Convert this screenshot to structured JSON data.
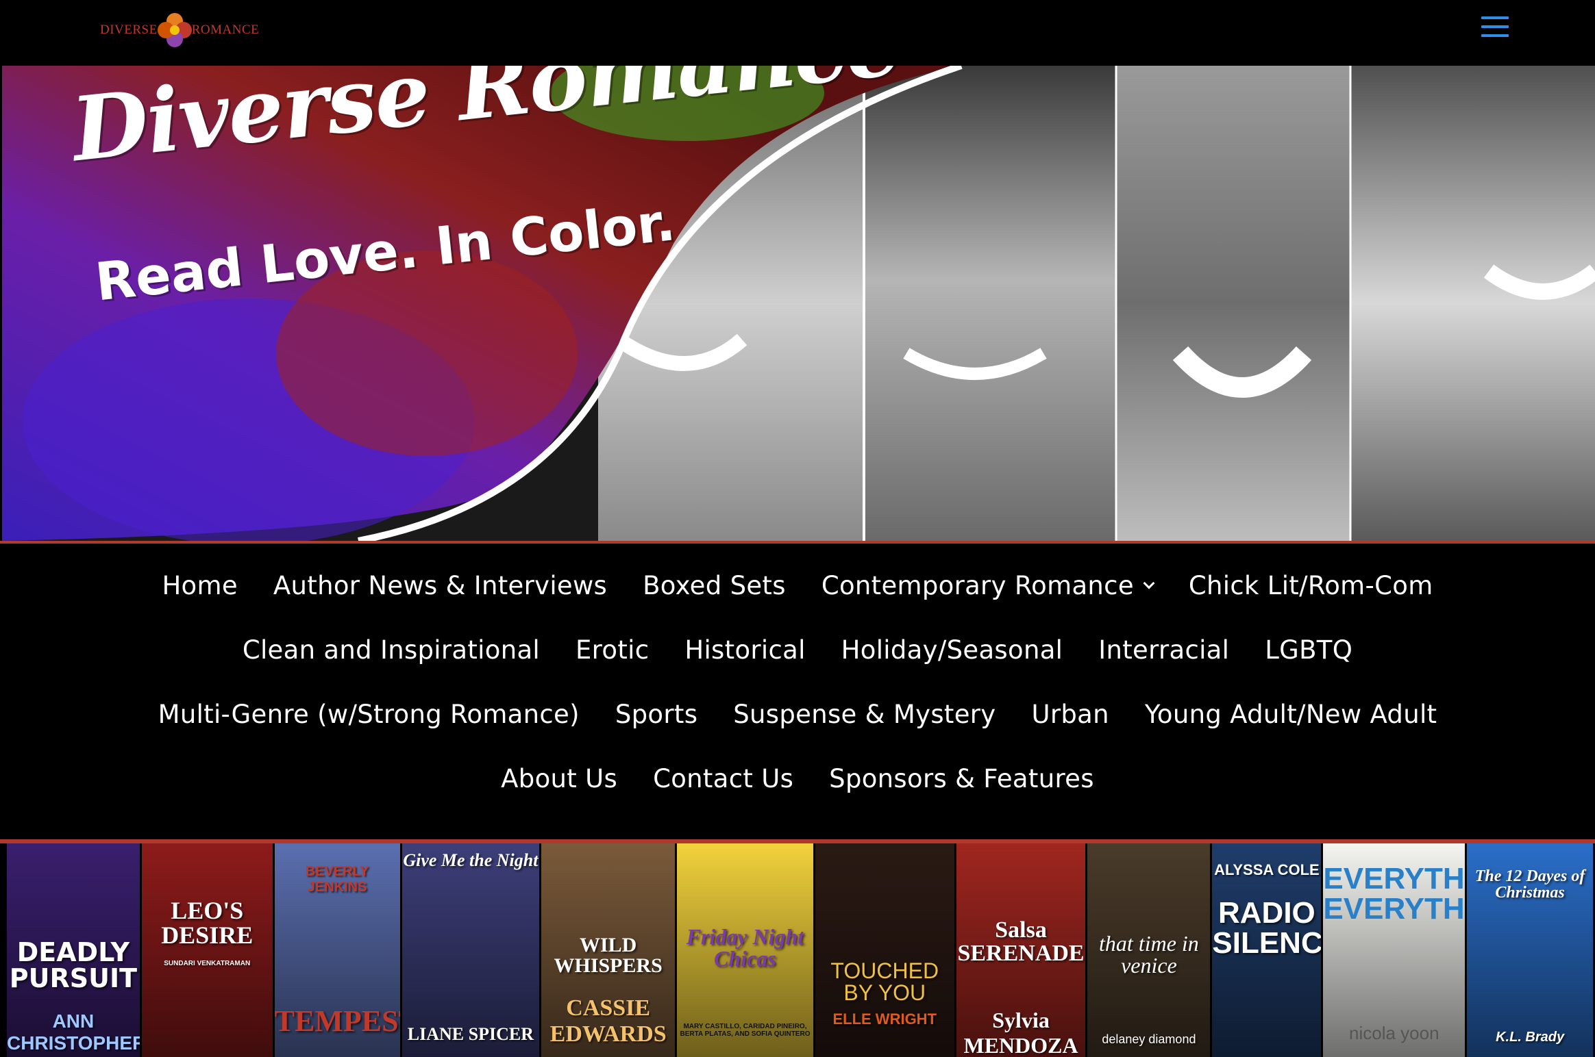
{
  "header": {
    "logo_left": "DIVERSE",
    "logo_right": "ROMANCE",
    "menu_icon": "hamburger-menu-icon",
    "accent_color": "#2e8ee8"
  },
  "hero": {
    "title": "Diverse Romance",
    "tagline": "Read Love. In Color."
  },
  "nav": {
    "rows": [
      [
        {
          "label": "Home"
        },
        {
          "label": "Author News & Interviews"
        },
        {
          "label": "Boxed Sets"
        },
        {
          "label": "Contemporary Romance",
          "has_submenu": true
        },
        {
          "label": "Chick Lit/Rom-Com"
        }
      ],
      [
        {
          "label": "Clean and Inspirational"
        },
        {
          "label": "Erotic"
        },
        {
          "label": "Historical"
        },
        {
          "label": "Holiday/Seasonal"
        },
        {
          "label": "Interracial"
        },
        {
          "label": "LGBTQ"
        }
      ],
      [
        {
          "label": "Multi-Genre (w/Strong Romance)"
        },
        {
          "label": "Sports"
        },
        {
          "label": "Suspense & Mystery"
        },
        {
          "label": "Urban"
        },
        {
          "label": "Young Adult/New Adult"
        }
      ],
      [
        {
          "label": "About Us"
        },
        {
          "label": "Contact Us"
        },
        {
          "label": "Sponsors & Features"
        }
      ]
    ]
  },
  "books": [
    {
      "title": "DEADLY PURSUIT",
      "author": "ANN CHRISTOPHER",
      "bg": "#3a1f6e"
    },
    {
      "title": "LEO'S DESIRE",
      "author": "SUNDARI VENKATRAMAN",
      "bg": "#8e1b1b"
    },
    {
      "title": "TEMPEST",
      "author": "BEVERLY JENKINS",
      "bg": "#5b6fb0"
    },
    {
      "title": "Give Me the Night",
      "author": "LIANE SPICER",
      "bg": "#3d3f7a"
    },
    {
      "title": "WILD WHISPERS",
      "author": "CASSIE EDWARDS",
      "bg": "#7a5a3a"
    },
    {
      "title": "Friday Night Chicas",
      "author": "MARY CASTILLO, CARIDAD PINEIRO, BERTA PLATAS, AND SOFIA QUINTERO",
      "bg": "#f2d23c"
    },
    {
      "title": "TOUCHED BY YOU",
      "author": "ELLE WRIGHT",
      "bg": "#2b1a14"
    },
    {
      "title": "Salsa SERENADE",
      "author": "Sylvia MENDOZA",
      "bg": "#a0261f"
    },
    {
      "title": "that time in venice",
      "author": "delaney diamond",
      "bg": "#4a3b2a"
    },
    {
      "title": "RADIO SILENCE",
      "author": "ALYSSA COLE",
      "bg": "#1f3d6b"
    },
    {
      "title": "EVERYTHING, EVERYTHING",
      "author": "nicola yoon",
      "bg": "#f4f4f0"
    },
    {
      "title": "The 12 Dayes of Christmas",
      "author": "K.L. Brady",
      "bg": "#2a6ec9"
    }
  ]
}
